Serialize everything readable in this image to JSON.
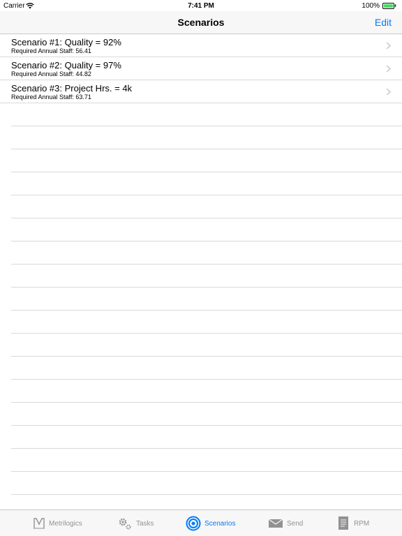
{
  "status_bar": {
    "carrier": "Carrier",
    "time": "7:41 PM",
    "battery_percent": "100%"
  },
  "nav": {
    "title": "Scenarios",
    "edit_label": "Edit"
  },
  "scenarios": [
    {
      "title": "Scenario #1: Quality = 92%",
      "subtitle": "Required Annual Staff: 56.41"
    },
    {
      "title": "Scenario #2: Quality = 97%",
      "subtitle": "Required Annual Staff: 44.82"
    },
    {
      "title": "Scenario #3: Project Hrs. = 4k",
      "subtitle": "Required Annual Staff: 63.71"
    }
  ],
  "tabs": [
    {
      "label": "Metrilogics",
      "icon": "metrilogics-logo-icon",
      "active": false
    },
    {
      "label": "Tasks",
      "icon": "gears-icon",
      "active": false
    },
    {
      "label": "Scenarios",
      "icon": "target-icon",
      "active": true
    },
    {
      "label": "Send",
      "icon": "envelope-icon",
      "active": false
    },
    {
      "label": "RPM",
      "icon": "document-icon",
      "active": false
    }
  ],
  "colors": {
    "accent": "#007aff",
    "inactive_tab": "#929292",
    "battery": "#4cd964",
    "separator": "#d9d9dd"
  }
}
